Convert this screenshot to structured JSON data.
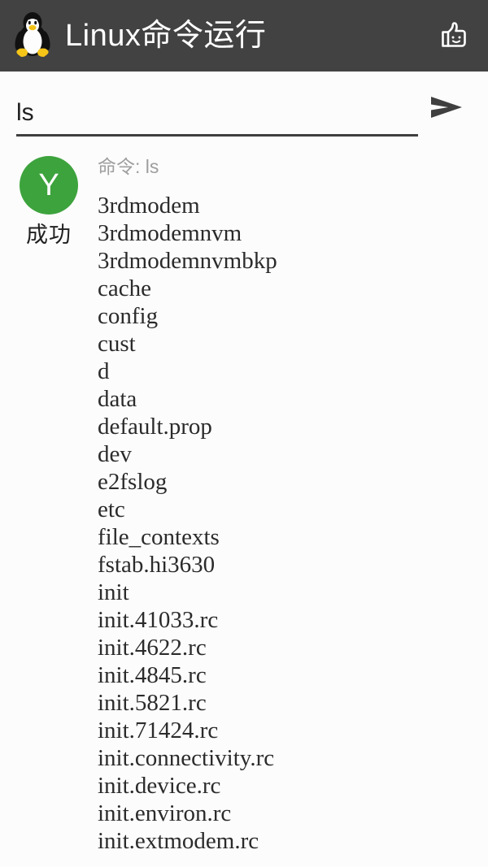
{
  "appbar": {
    "logo_icon": "tux-penguin-logo",
    "title": "Linux命令运行",
    "action_icon": "thumbs-up-icon"
  },
  "command_input": {
    "value": "ls",
    "placeholder": "",
    "send_icon": "send-arrow-icon"
  },
  "result": {
    "status_initial": "Y",
    "status_label": "成功",
    "status_color": "#3da33d",
    "command_prefix": "命令: ",
    "command_value": "ls",
    "output_lines": [
      "3rdmodem",
      "3rdmodemnvm",
      "3rdmodemnvmbkp",
      "cache",
      "config",
      "cust",
      "d",
      "data",
      "default.prop",
      "dev",
      "e2fslog",
      "etc",
      "file_contexts",
      "fstab.hi3630",
      "init",
      "init.41033.rc",
      "init.4622.rc",
      "init.4845.rc",
      "init.5821.rc",
      "init.71424.rc",
      "init.connectivity.rc",
      "init.device.rc",
      "init.environ.rc",
      "init.extmodem.rc"
    ]
  },
  "theme": {
    "appbar_bg": "#424242",
    "page_bg": "#fcfcfc",
    "text_primary": "#2b2b2b",
    "text_muted": "#9e9e9e"
  }
}
